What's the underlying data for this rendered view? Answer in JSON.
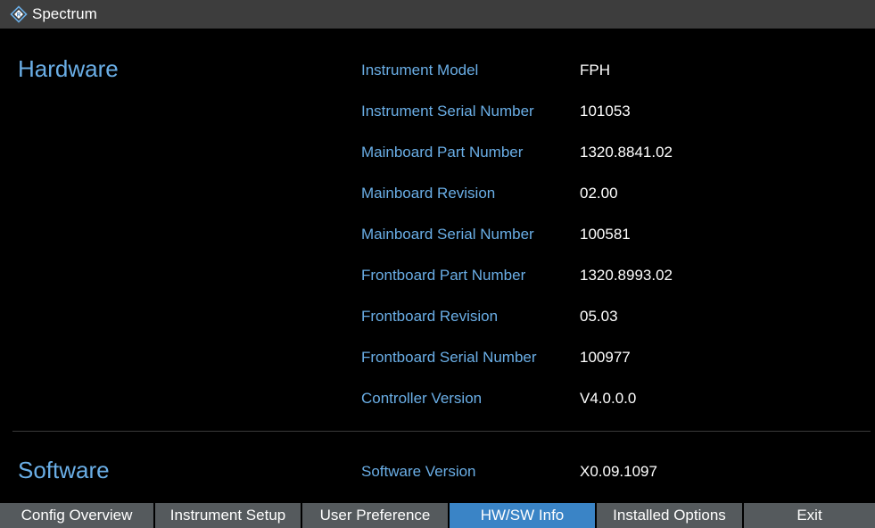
{
  "titlebar": {
    "title": "Spectrum",
    "logo_icon": "rohde-schwarz-logo-icon"
  },
  "hardware": {
    "title": "Hardware",
    "rows": [
      {
        "label": "Instrument Model",
        "value": "FPH"
      },
      {
        "label": "Instrument Serial Number",
        "value": "101053"
      },
      {
        "label": "Mainboard Part Number",
        "value": "1320.8841.02"
      },
      {
        "label": "Mainboard Revision",
        "value": "02.00"
      },
      {
        "label": "Mainboard Serial Number",
        "value": "100581"
      },
      {
        "label": "Frontboard Part Number",
        "value": "1320.8993.02"
      },
      {
        "label": "Frontboard Revision",
        "value": "05.03"
      },
      {
        "label": "Frontboard Serial Number",
        "value": "100977"
      },
      {
        "label": "Controller Version",
        "value": "V4.0.0.0"
      }
    ]
  },
  "software": {
    "title": "Software",
    "rows": [
      {
        "label": "Software Version",
        "value": "X0.09.1097"
      }
    ]
  },
  "tabs": [
    {
      "label": "Config Overview",
      "active": false
    },
    {
      "label": "Instrument Setup",
      "active": false
    },
    {
      "label": "User Preference",
      "active": false
    },
    {
      "label": "HW/SW Info",
      "active": true
    },
    {
      "label": "Installed Options",
      "active": false
    },
    {
      "label": "Exit",
      "active": false
    }
  ],
  "colors": {
    "accent": "#6aaee6",
    "active_tab": "#3a84c6",
    "tab": "#555a5d",
    "titlebar": "#3d3d3d"
  }
}
